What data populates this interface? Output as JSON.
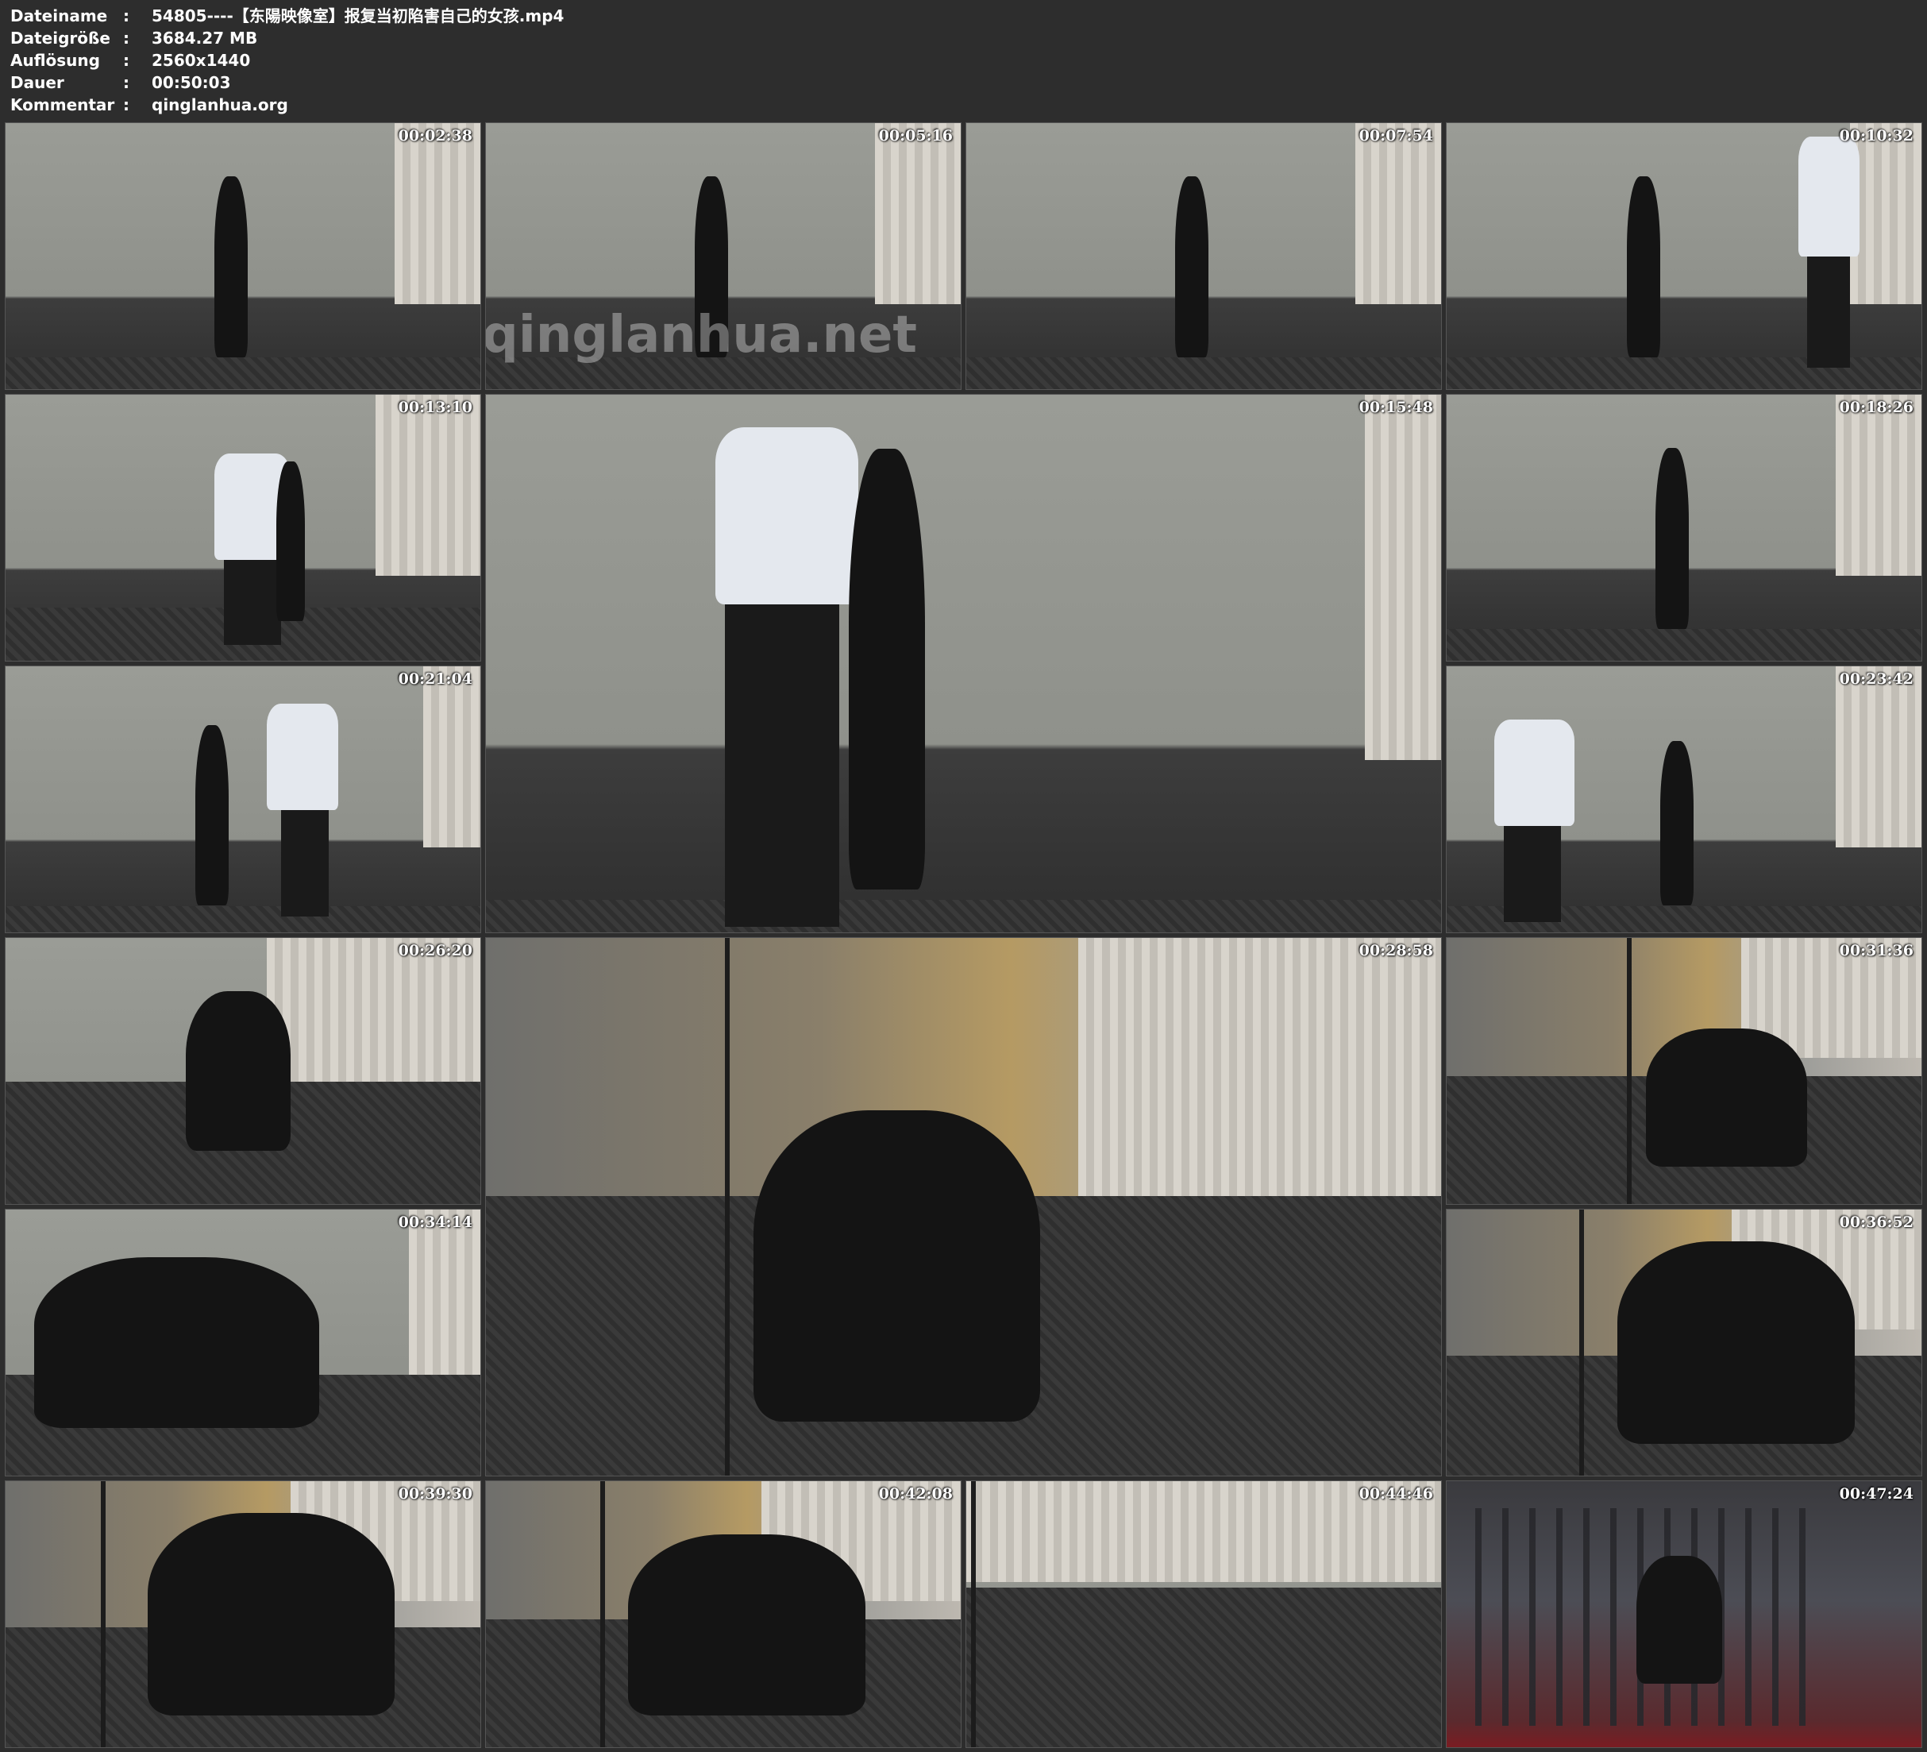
{
  "meta": [
    {
      "label": "Dateiname",
      "value": "54805----【东陽映像室】报复当初陷害自己的女孩.mp4"
    },
    {
      "label": "Dateigröße",
      "value": "3684.27 MB"
    },
    {
      "label": "Auflösung",
      "value": "2560x1440"
    },
    {
      "label": "Dauer",
      "value": "00:50:03"
    },
    {
      "label": "Kommentar",
      "value": "qinglanhua.org"
    }
  ],
  "separator": ":",
  "thumbnails": [
    {
      "timestamp": "00:02:38"
    },
    {
      "timestamp": "00:05:16"
    },
    {
      "timestamp": "00:07:54"
    },
    {
      "timestamp": "00:10:32"
    },
    {
      "timestamp": "00:13:10"
    },
    {
      "timestamp": "00:15:48"
    },
    {
      "timestamp": "00:18:26"
    },
    {
      "timestamp": "00:21:04"
    },
    {
      "timestamp": "00:23:42"
    },
    {
      "timestamp": "00:26:20"
    },
    {
      "timestamp": "00:28:58"
    },
    {
      "timestamp": "00:31:36"
    },
    {
      "timestamp": "00:34:14"
    },
    {
      "timestamp": "00:36:52"
    },
    {
      "timestamp": "00:39:30"
    },
    {
      "timestamp": "00:42:08"
    },
    {
      "timestamp": "00:44:46"
    },
    {
      "timestamp": "00:47:24"
    }
  ],
  "watermark": "qinglanhua.net"
}
